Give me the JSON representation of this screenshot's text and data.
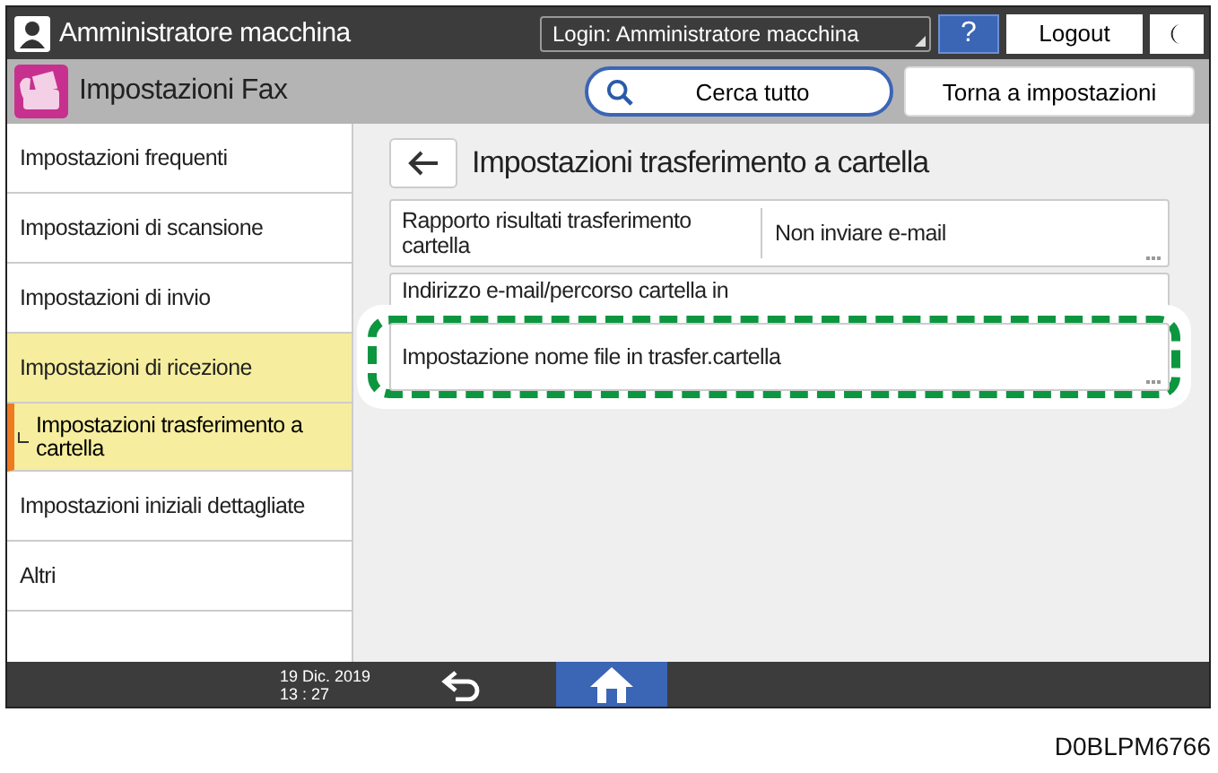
{
  "header": {
    "user": "Amministratore macchina",
    "login": "Login: Amministratore macchina",
    "help": "?",
    "logout": "Logout"
  },
  "subheader": {
    "title": "Impostazioni Fax",
    "search": "Cerca tutto",
    "back": "Torna a impostazioni"
  },
  "sidebar": {
    "items": [
      {
        "label": "Impostazioni frequenti",
        "expanded": false,
        "selected": false
      },
      {
        "label": "Impostazioni di scansione",
        "expanded": false,
        "selected": false
      },
      {
        "label": "Impostazioni di invio",
        "expanded": false,
        "selected": false
      },
      {
        "label": "Impostazioni di ricezione",
        "expanded": true,
        "selected": false,
        "children": [
          {
            "label": "Impostazioni trasferimento a cartella",
            "selected": true
          }
        ]
      },
      {
        "label": "Impostazioni iniziali dettagliate",
        "expanded": false,
        "selected": false
      },
      {
        "label": "Altri",
        "expanded": false,
        "selected": false
      }
    ]
  },
  "content": {
    "title": "Impostazioni trasferimento a cartella",
    "settings": [
      {
        "label": "Rapporto risultati trasferimento cartella",
        "value": "Non inviare e-mail",
        "highlighted": false
      },
      {
        "label": "Indirizzo e-mail/percorso cartella in",
        "highlighted": false
      },
      {
        "label": "Impostazione nome file in trasfer.cartella",
        "highlighted": true
      }
    ]
  },
  "status_bar": {
    "date": "19 Dic. 2019",
    "time": "13 : 27"
  },
  "caption": "D0BLPM6766"
}
